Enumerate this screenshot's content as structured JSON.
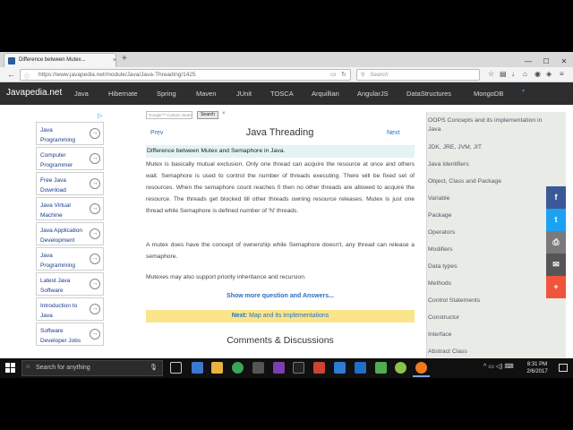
{
  "browser": {
    "tab_title": "Difference between Mutex...",
    "tab_close": "×",
    "new_tab": "+",
    "url": "https://www.javapedia.net/module/Java/Java-Threading/1425",
    "search_placeholder": "Search",
    "window_controls": [
      "—",
      "☐",
      "✕"
    ]
  },
  "site": {
    "logo": "Javapedia.net",
    "nav": [
      "Java",
      "Hibernate",
      "Spring",
      "Maven",
      "JUnit",
      "TOSCA",
      "Arquillian",
      "AngularJS",
      "DataStructures",
      "MongoDB"
    ],
    "nav_more": "▾"
  },
  "ads": {
    "adchoices": "▷",
    "items": [
      "Java Programming",
      "Computer Programmer",
      "Free Java Download",
      "Java Virtual Machine",
      "Java Application Development",
      "Java Programming",
      "Latest Java Software",
      "Introduction to Java",
      "Software Developer Jobs"
    ],
    "arrow": "→"
  },
  "gsearch": {
    "placeholder": "Google™ Custom Search",
    "button": "Search",
    "clear": "×"
  },
  "main": {
    "prev": "Prev",
    "title": "Java Threading",
    "next": "Next",
    "question": "Difference between Mutex and Semaphore in Java.",
    "para1": "Mutex is basically mutual exclusion. Only one thread can acquire the resource at once and others wait. Semaphore is used to control the number of threads executing. There will be fixed set of resources. When the semaphore count reaches 0 then no other threads are allowed to acquire the resource. The threads get blocked till other threads owning resource releases. Mutex is just one thread while Semaphore is defined number of 'N' threads.",
    "para2": "A mutex does have the concept of ownership while Semaphore doesn't, any thread can release a semaphore.",
    "para3": "Mutexes may also support priority inheritance and recursion.",
    "show_more": "Show more question and Answers...",
    "next_label": "Next:",
    "next_text": "Map and its implementations",
    "comments": "Comments & Discussions"
  },
  "sidebar": {
    "items": [
      "OOPS Concepts and its implementation in Java",
      "JDK, JRE, JVM, JIT",
      "Java Identifiers",
      "Object, Class and Package",
      "Variable",
      "Package",
      "Operators",
      "Modifiers",
      "Data types",
      "Methods",
      "Control Statements",
      "Constructor",
      "Interface",
      "Abstract Class"
    ]
  },
  "share": {
    "buttons": [
      "f",
      "t",
      "⎙",
      "✉",
      "+"
    ],
    "colors": [
      "#3b5998",
      "#1da1f2",
      "#7a7a7a",
      "#555555",
      "#f0543c"
    ]
  },
  "taskbar": {
    "search_placeholder": "Search for anything",
    "time": "8:31 PM",
    "date": "2/6/2017",
    "tray": "^ ▭ ◁) ⌨"
  }
}
